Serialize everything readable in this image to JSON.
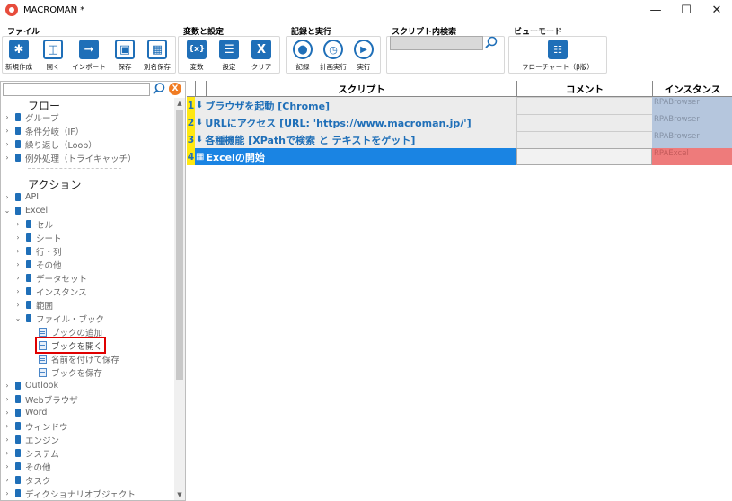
{
  "window": {
    "title": "MACROMAN *"
  },
  "ribbon": {
    "groups": [
      {
        "label": "ファイル",
        "buttons": [
          "新規作成",
          "開く",
          "インポート",
          "保存",
          "別名保存"
        ]
      },
      {
        "label": "変数と設定",
        "buttons": [
          "変数",
          "設定",
          "クリア"
        ]
      },
      {
        "label": "記録と実行",
        "buttons": [
          "記録",
          "計画実行",
          "実行"
        ]
      },
      {
        "label": "スクリプト内検索"
      },
      {
        "label": "ビューモード",
        "buttons": [
          "フローチャート（β版）"
        ]
      }
    ],
    "search_value": ""
  },
  "tree": {
    "flow_header": "フロー",
    "flow_items": [
      "グループ",
      "条件分岐（IF）",
      "繰り返し（Loop）",
      "例外処理（トライキャッチ）"
    ],
    "action_header": "アクション",
    "action_items": [
      "API",
      "Excel"
    ],
    "excel_children": [
      "セル",
      "シート",
      "行・列",
      "その他",
      "データセット",
      "インスタンス",
      "範囲",
      "ファイル・ブック"
    ],
    "file_book_children": [
      "ブックの追加",
      "ブックを開く",
      "名前を付けて保存",
      "ブックを保存"
    ],
    "more_items": [
      "Outlook",
      "Webブラウザ",
      "Word",
      "ウィンドウ",
      "エンジン",
      "システム",
      "その他",
      "タスク",
      "ディクショナリオブジェクト"
    ]
  },
  "grid": {
    "headers": {
      "script": "スクリプト",
      "comment": "コメント",
      "instance": "インスタンス"
    },
    "rows": [
      {
        "num": "1",
        "script": "ブラウザを起動 [Chrome]",
        "comment": "",
        "instance": "RPABrowser"
      },
      {
        "num": "2",
        "script": "URLにアクセス [URL: 'https://www.macroman.jp/']",
        "comment": "",
        "instance": "RPABrowser"
      },
      {
        "num": "3",
        "script": "各種機能 [XPathで検索 と テキストをゲット]",
        "comment": "",
        "instance": "RPABrowser"
      },
      {
        "num": "4",
        "script": "Excelの開始",
        "comment": "",
        "instance": "RPAExcel"
      }
    ]
  },
  "colors": {
    "accent": "#1f6fb8",
    "selected_row": "#1a84e3",
    "row_number_bg": "#ffe812",
    "instance_browser": "#b5c6dd",
    "instance_excel": "#ee7b7b",
    "highlight_box": "#e00000"
  }
}
